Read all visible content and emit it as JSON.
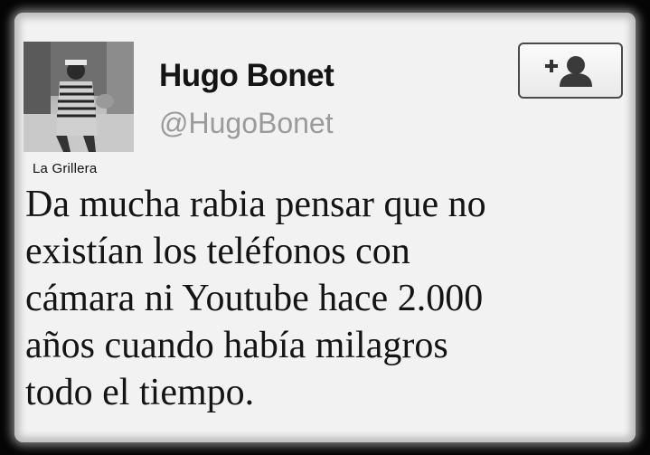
{
  "profile": {
    "display_name": "Hugo Bonet",
    "handle": "@HugoBonet",
    "avatar_icon": "profile-photo"
  },
  "watermark": "La Grillera",
  "follow_button": {
    "icon": "add-user-icon"
  },
  "tweet": {
    "lines": [
      "Da mucha rabia pensar que no",
      "existían los teléfonos con",
      "cámara ni Youtube hace 2.000",
      "años cuando había milagros",
      "todo el tiempo."
    ]
  },
  "colors": {
    "card_background": "#f2f2f2",
    "frame": "#050505",
    "name_text": "#141414",
    "handle_text": "#9b9b9b"
  }
}
